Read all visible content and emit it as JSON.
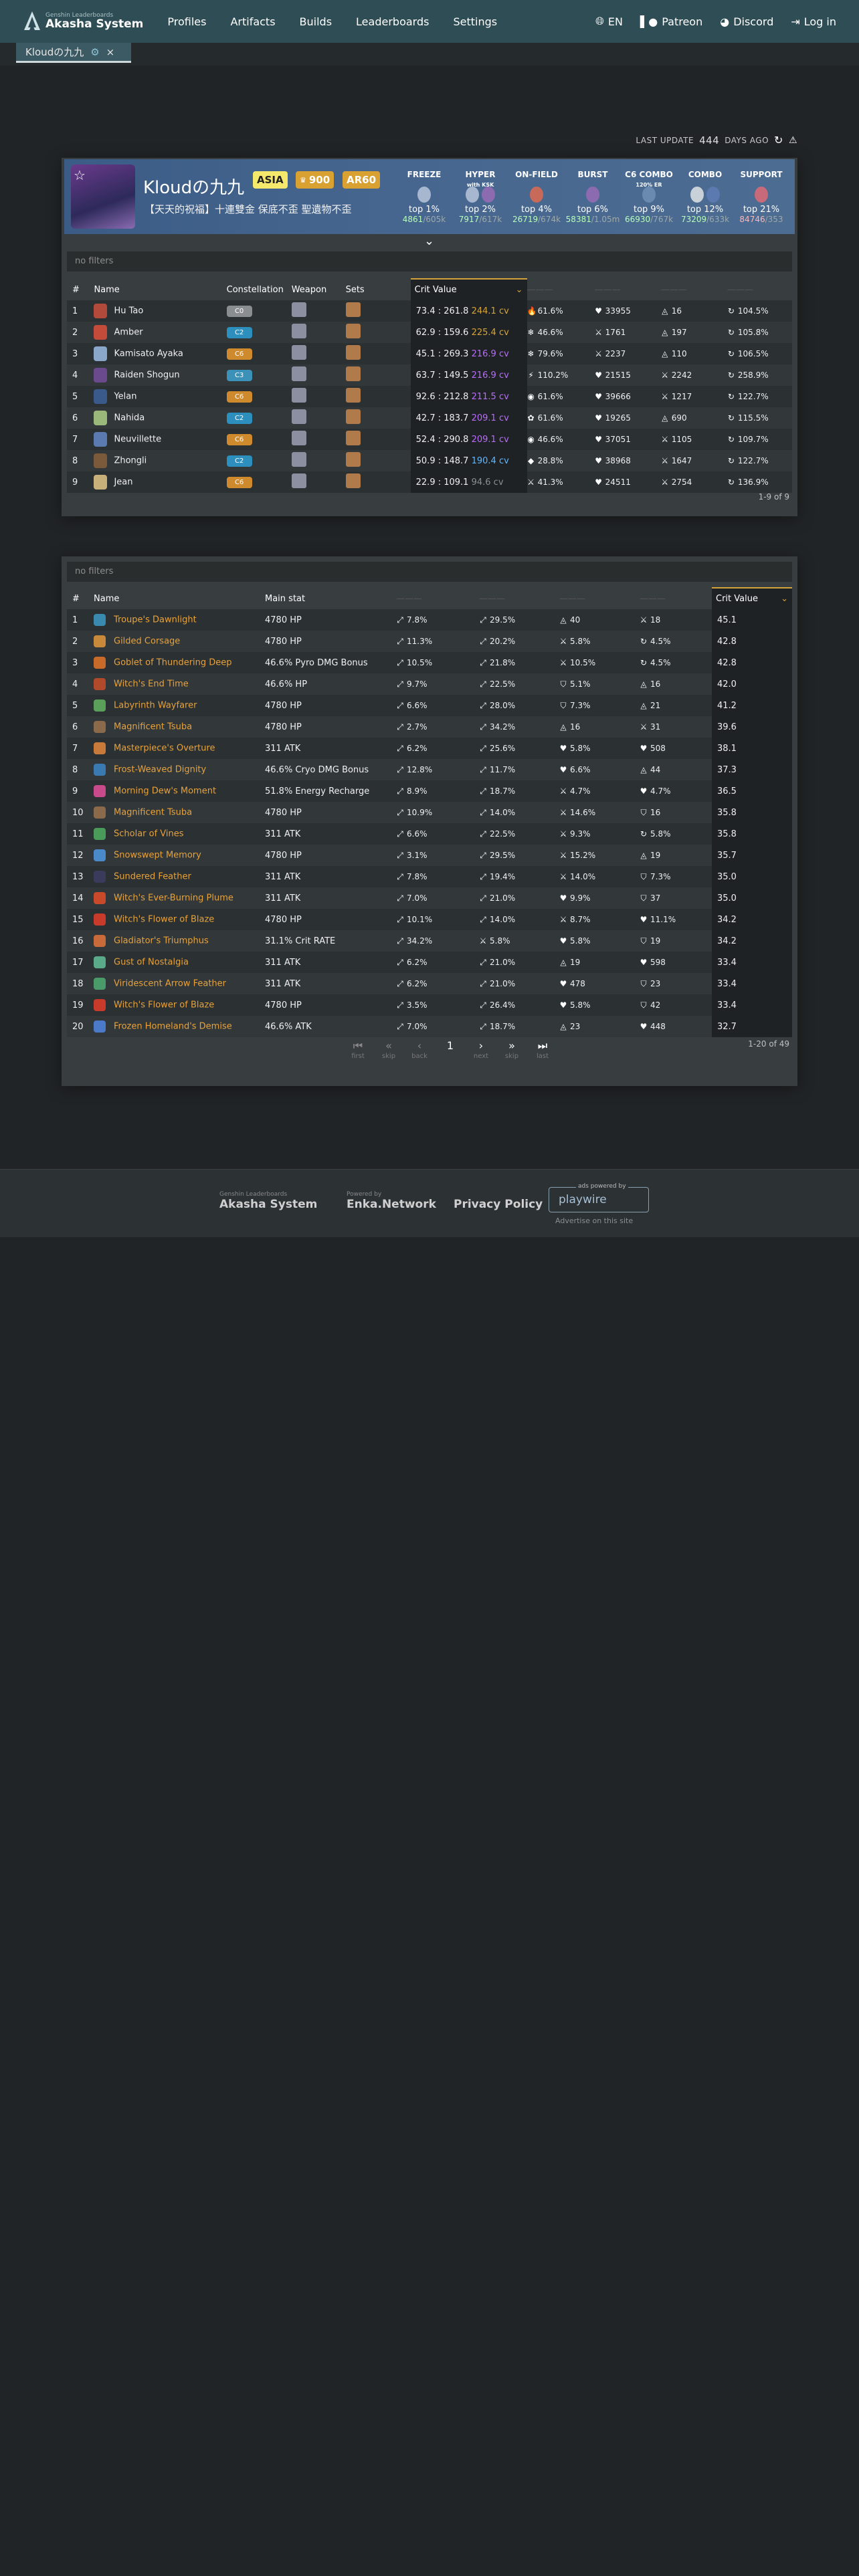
{
  "nav": {
    "logo_small": "Genshin Leaderboards",
    "logo_big": "Akasha System",
    "links": [
      "Profiles",
      "Artifacts",
      "Builds",
      "Leaderboards",
      "Settings"
    ],
    "lang": "EN",
    "patreon": "Patreon",
    "discord": "Discord",
    "login": "Log in"
  },
  "tab": {
    "label": "Kloudの九九",
    "close": "×"
  },
  "update": {
    "label": "LAST UPDATE",
    "days": "444",
    "suffix": "DAYS AGO"
  },
  "profile": {
    "name": "Kloudの九九",
    "region": "ASIA",
    "achievements": "900",
    "ar": "AR60",
    "signature": "【天天的祝福】十連雙金 保底不歪 聖遺物不歪"
  },
  "leaderboards": [
    {
      "title": "FREEZE",
      "sub": "",
      "top": "top 1%",
      "rank": "4861",
      "total": "/605k"
    },
    {
      "title": "HYPER",
      "sub": "with KSK",
      "top": "top 2%",
      "rank": "7917",
      "total": "/617k"
    },
    {
      "title": "ON-FIELD",
      "sub": "",
      "top": "top 4%",
      "rank": "26719",
      "total": "/674k"
    },
    {
      "title": "BURST",
      "sub": "",
      "top": "top 6%",
      "rank": "58381",
      "total": "/1.05m"
    },
    {
      "title": "C6 COMBO",
      "sub": "120% ER",
      "top": "top 9%",
      "rank": "66930",
      "total": "/767k"
    },
    {
      "title": "COMBO",
      "sub": "",
      "top": "top 12%",
      "rank": "73209",
      "total": "/633k"
    },
    {
      "title": "SUPPORT",
      "sub": "",
      "top": "top 21%",
      "rank": "84746",
      "total": "/353"
    }
  ],
  "builds": {
    "filter": "no filters",
    "headers": [
      "#",
      "Name",
      "Constellation",
      "Weapon",
      "Sets",
      "Crit Value"
    ],
    "rows": [
      {
        "n": "1",
        "name": "Hu Tao",
        "c": "C0",
        "cc": "c0",
        "ratio": "73.4 : 261.8",
        "cv": "244.1 cv",
        "cvc": "cv-r",
        "s1": "61.6%",
        "s1i": "🔥",
        "s2": "33955",
        "s2i": "♥",
        "s3": "16",
        "s3i": "◬",
        "s4": "104.5%",
        "s4i": "↻",
        "ic": "#b24a3c"
      },
      {
        "n": "2",
        "name": "Amber",
        "c": "C2",
        "cc": "c2",
        "ratio": "62.9 : 159.6",
        "cv": "225.4 cv",
        "cvc": "cv-r",
        "s1": "46.6%",
        "s1i": "❄",
        "s2": "1761",
        "s2i": "⚔",
        "s3": "197",
        "s3i": "◬",
        "s4": "105.8%",
        "s4i": "↻",
        "ic": "#c44a3a"
      },
      {
        "n": "3",
        "name": "Kamisato Ayaka",
        "c": "C6",
        "cc": "c6",
        "ratio": "45.1 : 269.3",
        "cv": "216.9 cv",
        "cvc": "cv-p",
        "s1": "79.6%",
        "s1i": "❄",
        "s2": "2237",
        "s2i": "⚔",
        "s3": "110",
        "s3i": "◬",
        "s4": "106.5%",
        "s4i": "↻",
        "ic": "#8aa6c8"
      },
      {
        "n": "4",
        "name": "Raiden Shogun",
        "c": "C3",
        "cc": "c3",
        "ratio": "63.7 : 149.5",
        "cv": "216.9 cv",
        "cvc": "cv-p",
        "s1": "110.2%",
        "s1i": "⚡",
        "s2": "21515",
        "s2i": "♥",
        "s3": "2242",
        "s3i": "⚔",
        "s4": "258.9%",
        "s4i": "↻",
        "ic": "#6a4a8c"
      },
      {
        "n": "5",
        "name": "Yelan",
        "c": "C6",
        "cc": "c6",
        "ratio": "92.6 : 212.8",
        "cv": "211.5 cv",
        "cvc": "cv-p",
        "s1": "61.6%",
        "s1i": "◉",
        "s2": "39666",
        "s2i": "♥",
        "s3": "1217",
        "s3i": "⚔",
        "s4": "122.7%",
        "s4i": "↻",
        "ic": "#3a5a8c"
      },
      {
        "n": "6",
        "name": "Nahida",
        "c": "C2",
        "cc": "c2",
        "ratio": "42.7 : 183.7",
        "cv": "209.1 cv",
        "cvc": "cv-p",
        "s1": "61.6%",
        "s1i": "✿",
        "s2": "19265",
        "s2i": "♥",
        "s3": "690",
        "s3i": "◬",
        "s4": "115.5%",
        "s4i": "↻",
        "ic": "#9ab87a"
      },
      {
        "n": "7",
        "name": "Neuvillette",
        "c": "C6",
        "cc": "c6",
        "ratio": "52.4 : 290.8",
        "cv": "209.1 cv",
        "cvc": "cv-p",
        "s1": "46.6%",
        "s1i": "◉",
        "s2": "37051",
        "s2i": "♥",
        "s3": "1105",
        "s3i": "⚔",
        "s4": "109.7%",
        "s4i": "↻",
        "ic": "#5a7ab0"
      },
      {
        "n": "8",
        "name": "Zhongli",
        "c": "C2",
        "cc": "c2",
        "ratio": "50.9 : 148.7",
        "cv": "190.4 cv",
        "cvc": "cv-b",
        "s1": "28.8%",
        "s1i": "◆",
        "s2": "38968",
        "s2i": "♥",
        "s3": "1647",
        "s3i": "⚔",
        "s4": "122.7%",
        "s4i": "↻",
        "ic": "#7a5a3a"
      },
      {
        "n": "9",
        "name": "Jean",
        "c": "C6",
        "cc": "c6",
        "ratio": "22.9 : 109.1",
        "cv": "94.6 cv",
        "cvc": "cv-g",
        "s1": "41.3%",
        "s1i": "⚔",
        "s2": "24511",
        "s2i": "♥",
        "s3": "2754",
        "s3i": "⚔",
        "s4": "136.9%",
        "s4i": "↻",
        "ic": "#c8b07a"
      }
    ],
    "count": "1-9 of 9"
  },
  "artifacts": {
    "filter": "no filters",
    "headers": [
      "#",
      "Name",
      "Main stat",
      "Crit Value"
    ],
    "rows": [
      {
        "n": "1",
        "name": "Troupe's Dawnlight",
        "main": "4780 HP",
        "a": "7.8%",
        "ai": "⤢",
        "b": "29.5%",
        "bi": "⤢",
        "c": "40",
        "ci": "◬",
        "d": "18",
        "di": "⚔",
        "cv": "45.1",
        "cvc": "cv-r",
        "ic": "#3a8ab0"
      },
      {
        "n": "2",
        "name": "Gilded Corsage",
        "main": "4780 HP",
        "a": "11.3%",
        "ai": "⤢",
        "b": "20.2%",
        "bi": "⤢",
        "c": "5.8%",
        "ci": "⚔",
        "d": "4.5%",
        "di": "↻",
        "cv": "42.8",
        "cvc": "cv-r",
        "ic": "#c88a3a"
      },
      {
        "n": "3",
        "name": "Goblet of Thundering Deep",
        "main": "46.6% Pyro DMG Bonus",
        "a": "10.5%",
        "ai": "⤢",
        "b": "21.8%",
        "bi": "⤢",
        "c": "10.5%",
        "ci": "⚔",
        "d": "4.5%",
        "di": "↻",
        "cv": "42.8",
        "cvc": "cv-r",
        "ic": "#c86a2a"
      },
      {
        "n": "4",
        "name": "Witch's End Time",
        "main": "46.6% HP",
        "a": "9.7%",
        "ai": "⤢",
        "b": "22.5%",
        "bi": "⤢",
        "c": "5.1%",
        "ci": "⛉",
        "d": "16",
        "di": "◬",
        "cv": "42.0",
        "cvc": "cv-r",
        "ic": "#b04a2a"
      },
      {
        "n": "5",
        "name": "Labyrinth Wayfarer",
        "main": "4780 HP",
        "a": "6.6%",
        "ai": "⤢",
        "b": "28.0%",
        "bi": "⤢",
        "c": "7.3%",
        "ci": "⛉",
        "d": "21",
        "di": "◬",
        "cv": "41.2",
        "cvc": "cv-r",
        "ic": "#5aa05a"
      },
      {
        "n": "6",
        "name": "Magnificent Tsuba",
        "main": "4780 HP",
        "a": "2.7%",
        "ai": "⤢",
        "b": "34.2%",
        "bi": "⤢",
        "c": "16",
        "ci": "◬",
        "d": "31",
        "di": "⚔",
        "cv": "39.6",
        "cvc": "cv-r",
        "ic": "#8a6a4a"
      },
      {
        "n": "7",
        "name": "Masterpiece's Overture",
        "main": "311 ATK",
        "a": "6.2%",
        "ai": "⤢",
        "b": "25.6%",
        "bi": "⤢",
        "c": "5.8%",
        "ci": "♥",
        "d": "508",
        "di": "♥",
        "cv": "38.1",
        "cvc": "cv-r",
        "ic": "#c87a3a"
      },
      {
        "n": "8",
        "name": "Frost-Weaved Dignity",
        "main": "46.6% Cryo DMG Bonus",
        "a": "12.8%",
        "ai": "⤢",
        "b": "11.7%",
        "bi": "⤢",
        "c": "6.6%",
        "ci": "♥",
        "d": "44",
        "di": "◬",
        "cv": "37.3",
        "cvc": "cv-r",
        "ic": "#3a7ab0"
      },
      {
        "n": "9",
        "name": "Morning Dew's Moment",
        "main": "51.8% Energy Recharge",
        "a": "8.9%",
        "ai": "⤢",
        "b": "18.7%",
        "bi": "⤢",
        "c": "4.7%",
        "ci": "⚔",
        "d": "4.7%",
        "di": "♥",
        "cv": "36.5",
        "cvc": "cv-r",
        "ic": "#c84a8a"
      },
      {
        "n": "10",
        "name": "Magnificent Tsuba",
        "main": "4780 HP",
        "a": "10.9%",
        "ai": "⤢",
        "b": "14.0%",
        "bi": "⤢",
        "c": "14.6%",
        "ci": "⚔",
        "d": "16",
        "di": "⛉",
        "cv": "35.8",
        "cvc": "cv-r",
        "ic": "#8a6a4a"
      },
      {
        "n": "11",
        "name": "Scholar of Vines",
        "main": "311 ATK",
        "a": "6.6%",
        "ai": "⤢",
        "b": "22.5%",
        "bi": "⤢",
        "c": "9.3%",
        "ci": "⚔",
        "d": "5.8%",
        "di": "↻",
        "cv": "35.8",
        "cvc": "cv-r",
        "ic": "#4a9a5a"
      },
      {
        "n": "12",
        "name": "Snowswept Memory",
        "main": "4780 HP",
        "a": "3.1%",
        "ai": "⤢",
        "b": "29.5%",
        "bi": "⤢",
        "c": "15.2%",
        "ci": "⚔",
        "d": "19",
        "di": "◬",
        "cv": "35.7",
        "cvc": "cv-r",
        "ic": "#4a8ac8"
      },
      {
        "n": "13",
        "name": "Sundered Feather",
        "main": "311 ATK",
        "a": "7.8%",
        "ai": "⤢",
        "b": "19.4%",
        "bi": "⤢",
        "c": "14.0%",
        "ci": "⚔",
        "d": "7.3%",
        "di": "⛉",
        "cv": "35.0",
        "cvc": "cv-r",
        "ic": "#3a3a5a"
      },
      {
        "n": "14",
        "name": "Witch's Ever-Burning Plume",
        "main": "311 ATK",
        "a": "7.0%",
        "ai": "⤢",
        "b": "21.0%",
        "bi": "⤢",
        "c": "9.9%",
        "ci": "♥",
        "d": "37",
        "di": "⛉",
        "cv": "35.0",
        "cvc": "cv-r",
        "ic": "#c84a2a"
      },
      {
        "n": "15",
        "name": "Witch's Flower of Blaze",
        "main": "4780 HP",
        "a": "10.1%",
        "ai": "⤢",
        "b": "14.0%",
        "bi": "⤢",
        "c": "8.7%",
        "ci": "⚔",
        "d": "11.1%",
        "di": "♥",
        "cv": "34.2",
        "cvc": "cv-p",
        "ic": "#c83a2a"
      },
      {
        "n": "16",
        "name": "Gladiator's Triumphus",
        "main": "31.1% Crit RATE",
        "a": "34.2%",
        "ai": "⤢",
        "b": "5.8%",
        "bi": "⚔",
        "c": "5.8%",
        "ci": "♥",
        "d": "19",
        "di": "⛉",
        "cv": "34.2",
        "cvc": "cv-r",
        "ic": "#c86a3a"
      },
      {
        "n": "17",
        "name": "Gust of Nostalgia",
        "main": "311 ATK",
        "a": "6.2%",
        "ai": "⤢",
        "b": "21.0%",
        "bi": "⤢",
        "c": "19",
        "ci": "◬",
        "d": "598",
        "di": "♥",
        "cv": "33.4",
        "cvc": "cv-p",
        "ic": "#5aaa8a"
      },
      {
        "n": "18",
        "name": "Viridescent Arrow Feather",
        "main": "311 ATK",
        "a": "6.2%",
        "ai": "⤢",
        "b": "21.0%",
        "bi": "⤢",
        "c": "478",
        "ci": "♥",
        "d": "23",
        "di": "⛉",
        "cv": "33.4",
        "cvc": "cv-p",
        "ic": "#4a9a6a"
      },
      {
        "n": "19",
        "name": "Witch's Flower of Blaze",
        "main": "4780 HP",
        "a": "3.5%",
        "ai": "⤢",
        "b": "26.4%",
        "bi": "⤢",
        "c": "5.8%",
        "ci": "♥",
        "d": "42",
        "di": "⛉",
        "cv": "33.4",
        "cvc": "cv-p",
        "ic": "#c83a2a"
      },
      {
        "n": "20",
        "name": "Frozen Homeland's Demise",
        "main": "46.6% ATK",
        "a": "7.0%",
        "ai": "⤢",
        "b": "18.7%",
        "bi": "⤢",
        "c": "23",
        "ci": "◬",
        "d": "448",
        "di": "♥",
        "cv": "32.7",
        "cvc": "cv-p",
        "ic": "#4a7ac8"
      }
    ],
    "pager": {
      "first": "first",
      "skip_back": "skip",
      "back": "back",
      "page": "1",
      "next": "next",
      "skip_next": "skip",
      "last": "last"
    },
    "count": "1-20 of 49"
  },
  "footer": {
    "logo_small": "Genshin Leaderboards",
    "logo_big": "Akasha System",
    "enka_small": "Powered by",
    "enka_big": "Enka.Network",
    "privacy": "Privacy Policy",
    "ad_small": "ads powered by",
    "ad_main": "playwire",
    "ad_text": "Advertise on this site"
  }
}
